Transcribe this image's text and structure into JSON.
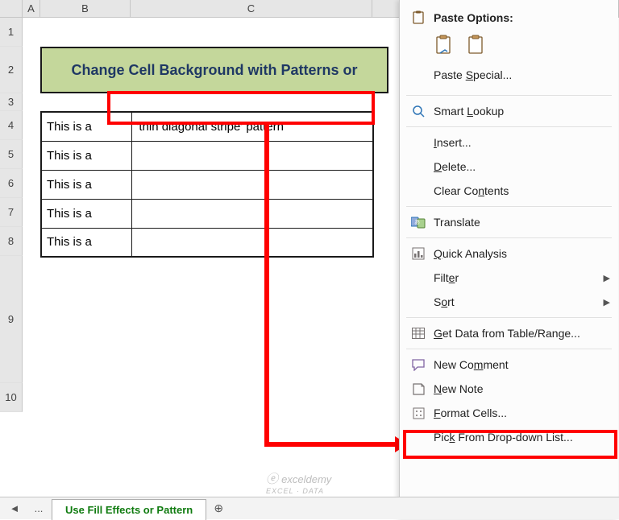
{
  "columns": {
    "a": "A",
    "b": "B",
    "c": "C"
  },
  "rows": [
    "1",
    "2",
    "3",
    "4",
    "5",
    "6",
    "7",
    "8",
    "9",
    "10"
  ],
  "title": "Change Cell Background with Patterns or",
  "table": [
    {
      "b": "This is a",
      "c": "'thin diagonal stripe' pattern"
    },
    {
      "b": "This is a",
      "c": ""
    },
    {
      "b": "This is a",
      "c": ""
    },
    {
      "b": "This is a",
      "c": ""
    },
    {
      "b": "This is a",
      "c": ""
    }
  ],
  "context_menu": {
    "paste_options": "Paste Options:",
    "items": {
      "paste_special": "Paste Special...",
      "smart_lookup": "Smart Lookup",
      "insert": "Insert...",
      "delete": "Delete...",
      "clear_contents": "Clear Contents",
      "translate": "Translate",
      "quick_analysis": "Quick Analysis",
      "filter": "Filter",
      "sort": "Sort",
      "get_data": "Get Data from Table/Range...",
      "new_comment": "New Comment",
      "new_note": "New Note",
      "format_cells": "Format Cells...",
      "pick_list": "Pick From Drop-down List..."
    }
  },
  "tabs": {
    "nav_back": "◄",
    "nav_more": "...",
    "active": "Use Fill Effects or Pattern",
    "add": "⊕"
  },
  "watermark": {
    "brand": "exceldemy",
    "sub": "EXCEL · DATA"
  }
}
